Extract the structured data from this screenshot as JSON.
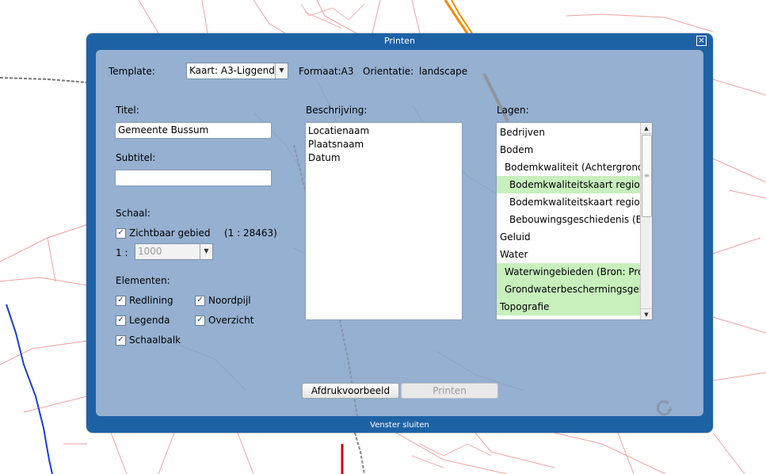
{
  "dialog": {
    "title": "Printen",
    "close_icon": "close-icon",
    "footer_label": "Venster sluiten"
  },
  "template": {
    "label": "Template:",
    "value": "Kaart: A3-Liggend",
    "format_label": "Formaat:A3",
    "orientation_label": "Orientatie:",
    "orientation_value": "landscape"
  },
  "title_field": {
    "label": "Titel:",
    "value": "Gemeente Bussum"
  },
  "subtitle_field": {
    "label": "Subtitel:",
    "value": ""
  },
  "scale": {
    "label": "Schaal:",
    "visible_area_label": "Zichtbaar gebied",
    "visible_area_checked": true,
    "current_scale": "(1 : 28463)",
    "prefix": "1 :",
    "value": "1000"
  },
  "elements": {
    "label": "Elementen:",
    "items": [
      {
        "label": "Redlining",
        "checked": true
      },
      {
        "label": "Noordpijl",
        "checked": true
      },
      {
        "label": "Legenda",
        "checked": true
      },
      {
        "label": "Overzicht",
        "checked": true
      },
      {
        "label": "Schaalbalk",
        "checked": true
      }
    ]
  },
  "description": {
    "label": "Beschrijving:",
    "lines": [
      "Locatienaam",
      "Plaatsnaam",
      "Datum"
    ]
  },
  "layers": {
    "label": "Lagen:",
    "items": [
      {
        "label": "Bedrijven",
        "level": 0,
        "highlighted": false
      },
      {
        "label": "Bodem",
        "level": 0,
        "highlighted": false
      },
      {
        "label": "Bodemkwaliteit (Achtergrondwa",
        "level": 1,
        "highlighted": false
      },
      {
        "label": "Bodemkwaliteitskaart regio, b",
        "level": 2,
        "highlighted": true
      },
      {
        "label": "Bodemkwaliteitskaart regio, o",
        "level": 2,
        "highlighted": false
      },
      {
        "label": "Bebouwingsgeschiedenis (Br",
        "level": 2,
        "highlighted": false
      },
      {
        "label": "Geluid",
        "level": 0,
        "highlighted": false
      },
      {
        "label": "Water",
        "level": 0,
        "highlighted": false
      },
      {
        "label": "Waterwingebieden (Bron: Provi",
        "level": 1,
        "highlighted": true
      },
      {
        "label": "Grondwaterbeschermingsgebi",
        "level": 1,
        "highlighted": true
      },
      {
        "label": "Topografie",
        "level": 0,
        "highlighted": true
      }
    ]
  },
  "buttons": {
    "preview": "Afdrukvoorbeeld",
    "print": "Printen"
  },
  "colors": {
    "dialog_frame": "#1e62a6",
    "panel": "#a0b6d4",
    "layer_highlight": "#c8f0bd",
    "map_roads": "#f08080",
    "map_highway": "#f08c00",
    "map_river": "#1a3fd1"
  }
}
